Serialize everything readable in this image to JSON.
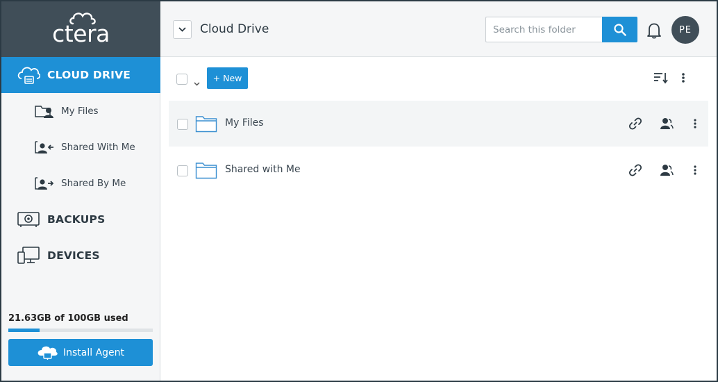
{
  "brand": {
    "logo_text": "ctera"
  },
  "sidebar": {
    "main_items": [
      {
        "label": "CLOUD DRIVE",
        "icon": "cloud-drive-icon",
        "active": true
      },
      {
        "label": "BACKUPS",
        "icon": "backup-icon",
        "active": false
      },
      {
        "label": "DEVICES",
        "icon": "devices-icon",
        "active": false
      }
    ],
    "sub_items": [
      {
        "label": "My Files",
        "icon": "my-files-icon"
      },
      {
        "label": "Shared With Me",
        "icon": "shared-with-me-icon"
      },
      {
        "label": "Shared By Me",
        "icon": "shared-by-me-icon"
      }
    ],
    "storage": {
      "text": "21.63GB of 100GB used",
      "used_fraction": 0.2163
    },
    "install_agent_label": "Install Agent"
  },
  "header": {
    "title": "Cloud Drive",
    "search_placeholder": "Search this folder",
    "avatar_initials": "PE"
  },
  "toolbar": {
    "new_label": "+ New"
  },
  "files": [
    {
      "name": "My Files",
      "icon": "folder-icon",
      "highlighted": true
    },
    {
      "name": "Shared with Me",
      "icon": "folder-icon",
      "highlighted": false
    }
  ],
  "colors": {
    "accent": "#1e90d6",
    "header_dark": "#404e58",
    "sidebar_bg": "#f5f6f7"
  }
}
